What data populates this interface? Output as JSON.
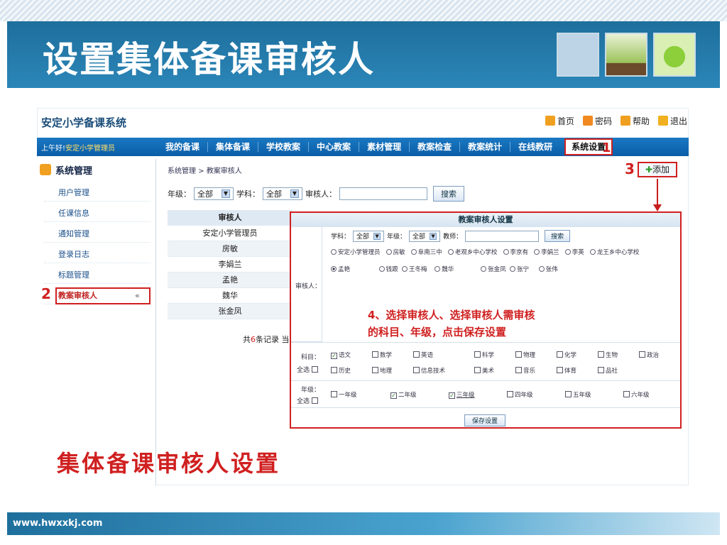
{
  "slide": {
    "title": "设置集体备课审核人",
    "footer": "www.hwxxkj.com",
    "caption": "集体备课审核人设置"
  },
  "app": {
    "system_title": "安定小学备课系统",
    "top_links": [
      "首页",
      "密码",
      "帮助",
      "退出"
    ],
    "greeting_prefix": "上午好!",
    "greeting_user": "安定小学管理员",
    "nav": [
      "我的备课",
      "集体备课",
      "学校教案",
      "中心教案",
      "素材管理",
      "教案检查",
      "教案统计",
      "在线教研"
    ],
    "nav_active": "系统设置"
  },
  "sidebar": {
    "title": "系统管理",
    "items": [
      "用户管理",
      "任课信息",
      "通知管理",
      "登录日志",
      "标题管理",
      "教案审核人"
    ],
    "collapse": "«"
  },
  "main": {
    "breadcrumb": "系统管理 > 教案审核人",
    "add_label": "添加",
    "filter": {
      "grade_label": "年级：",
      "grade_value": "全部",
      "subject_label": "学科：",
      "subject_value": "全部",
      "reviewer_label": "审核人：",
      "search": "搜索"
    },
    "table_header": "审核人",
    "rows": [
      "安定小学管理员",
      "房敏",
      "李娟兰",
      "孟艳",
      "魏华",
      "张金凤"
    ],
    "total_prefix": "共",
    "total_count": "6",
    "total_suffix": "条记录 当"
  },
  "dialog": {
    "title": "教案审核人设置",
    "subject_label": "学科：",
    "subject_value": "全部",
    "grade_label": "年级：",
    "grade_value": "全部",
    "teacher_label": "教师：",
    "search": "搜索",
    "reviewer_label": "审核人：",
    "teachers_row1": [
      "安定小学管理员",
      "房敏",
      "阜南三中",
      "老观乡中心学校",
      "李京有",
      "李娟兰",
      "李英",
      "龙王乡中心学校"
    ],
    "teachers_row2": [
      "孟艳",
      "钱跟",
      "王冬梅",
      "魏华",
      "张金凤",
      "张宁",
      "张伟"
    ],
    "subjects_label": "科目：",
    "select_all": "全选",
    "subjects_row1": [
      "语文",
      "数学",
      "英语",
      "科学",
      "物理",
      "化学",
      "生物",
      "政治"
    ],
    "subjects_row2": [
      "历史",
      "地理",
      "信息技术",
      "美术",
      "音乐",
      "体育",
      "品社"
    ],
    "grades_label": "年级：",
    "grades": [
      "一年级",
      "二年级",
      "三年级",
      "四年级",
      "五年级",
      "六年级"
    ],
    "save": "保存设置",
    "note_line1": "4、选择审核人、选择审核人需审核",
    "note_line2": "的科目、年级，点击保存设置"
  },
  "markers": [
    "1",
    "2",
    "3"
  ]
}
